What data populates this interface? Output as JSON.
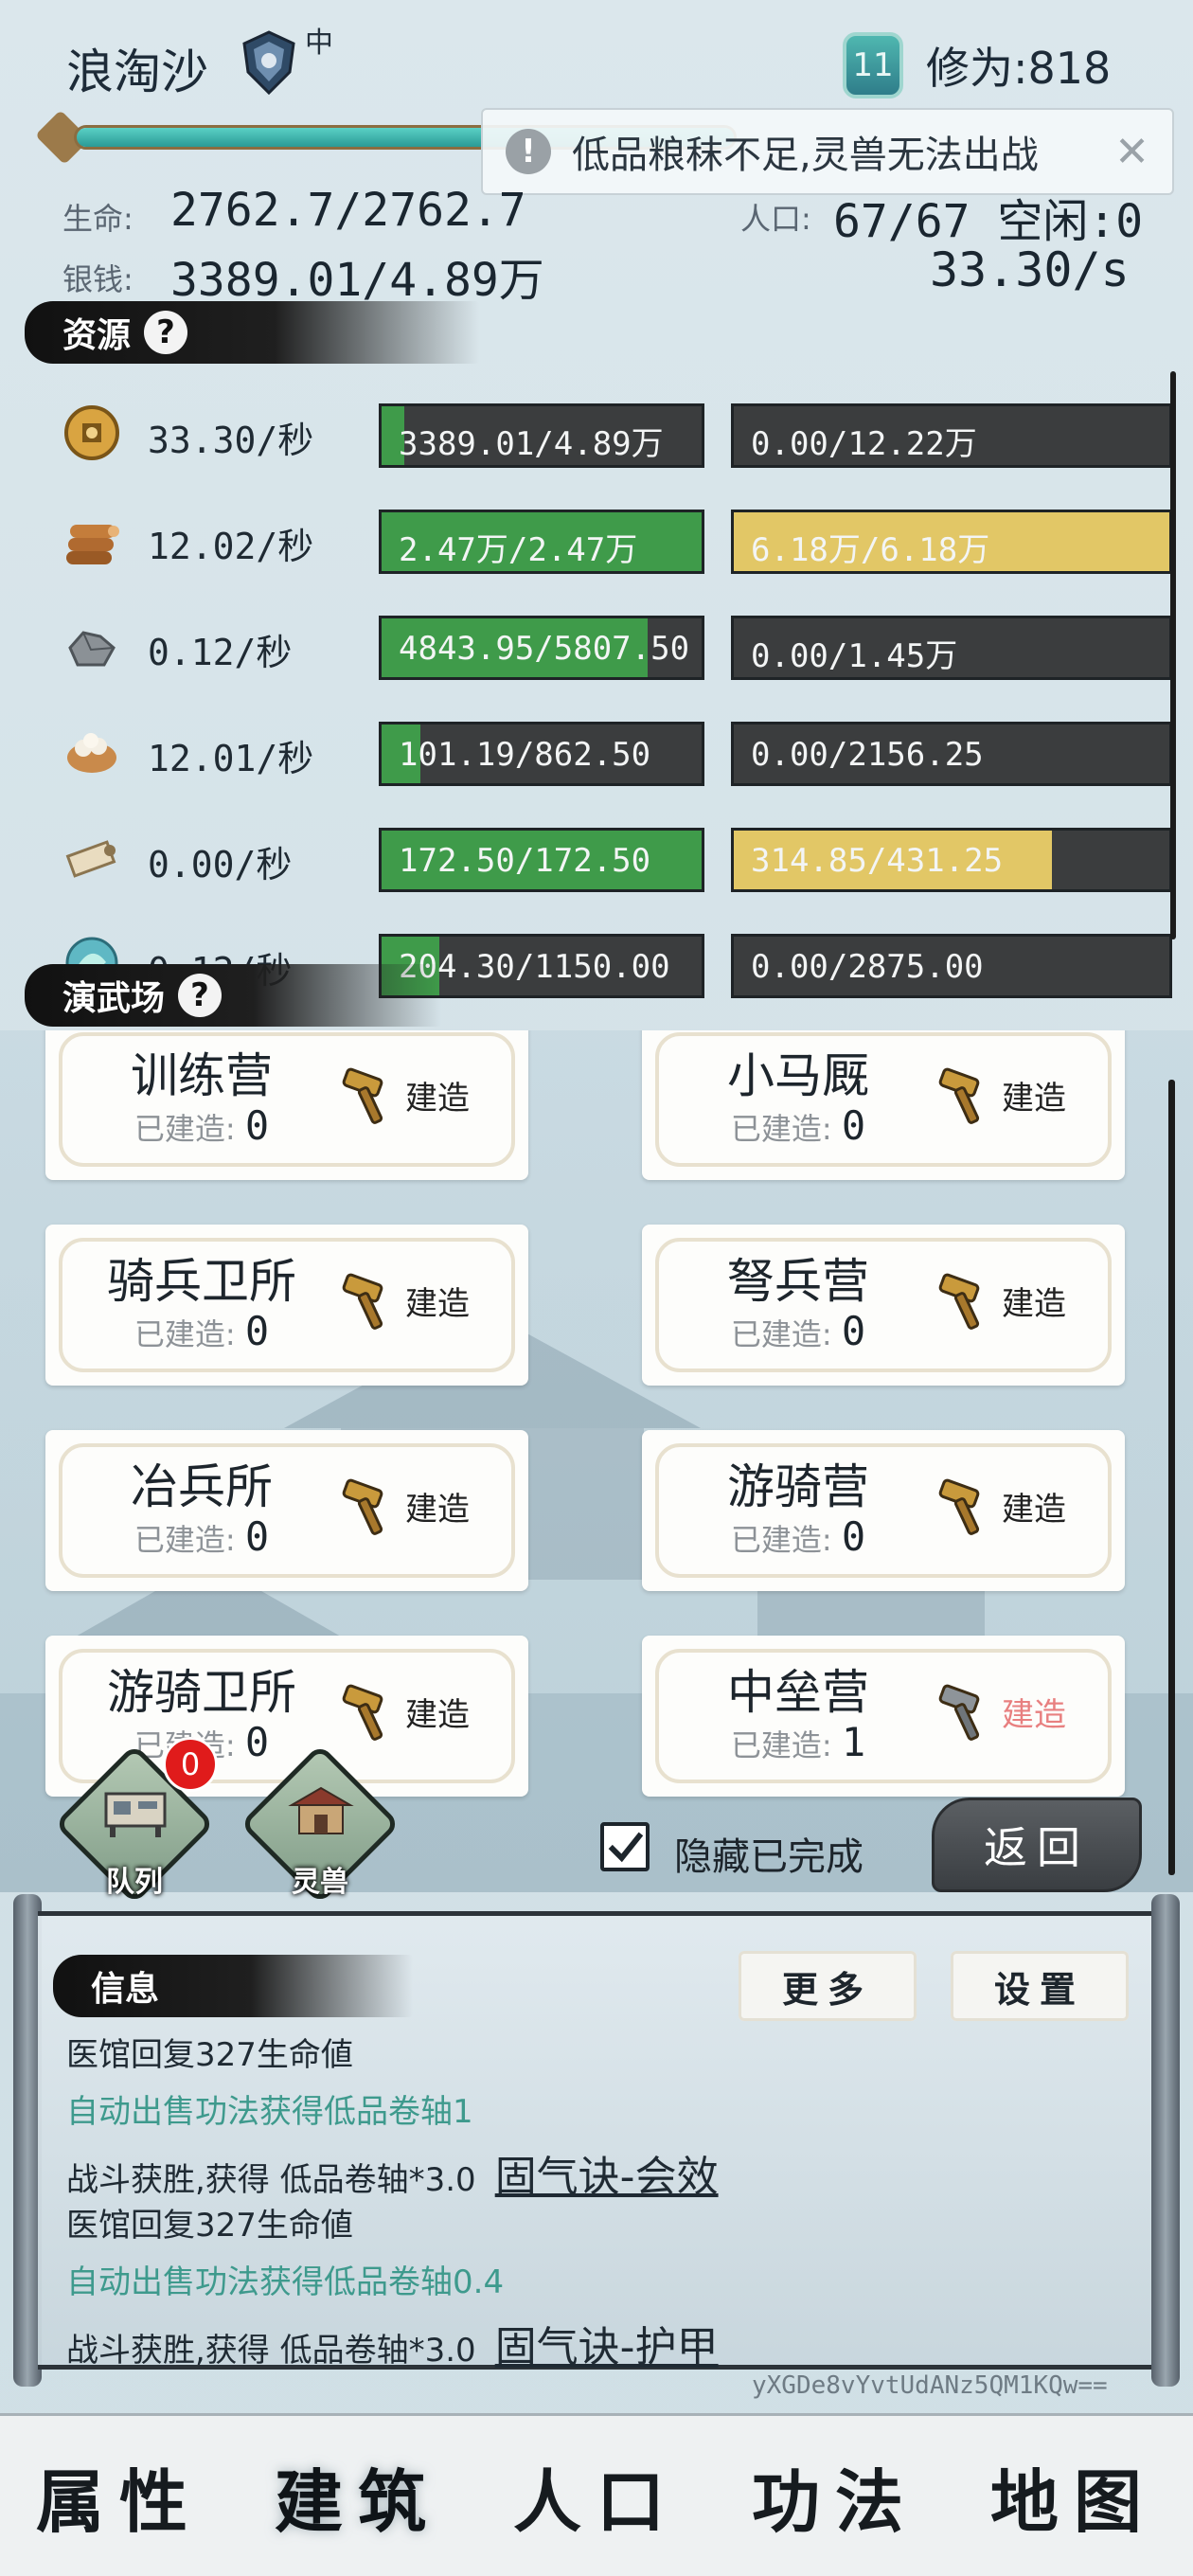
{
  "header": {
    "player_name": "浪淘沙",
    "rank_label": "中",
    "level": "11",
    "cultivation": "修为:818"
  },
  "toast": {
    "text": "低品粮秣不足,灵兽无法出战"
  },
  "stats": {
    "life_label": "生命:",
    "life_value": "2762.7/2762.7",
    "population_label": "人口:",
    "population_value": "67/67 空闲:0",
    "silver_label": "银钱:",
    "silver_value": "3389.01/4.89万",
    "silver_rate": "33.30/s",
    "hp_fraction": 1.0
  },
  "resources": {
    "header": "资源",
    "rows": [
      {
        "icon": "coin-icon",
        "rate": "33.30/秒",
        "a": "3389.01/4.89万",
        "a_fill": 0.07,
        "a_color": "g",
        "b": "0.00/12.22万",
        "b_fill": 0,
        "b_color": "y"
      },
      {
        "icon": "wood-logs-icon",
        "rate": "12.02/秒",
        "a": "2.47万/2.47万",
        "a_fill": 1.0,
        "a_color": "g",
        "b": "6.18万/6.18万",
        "b_fill": 1.0,
        "b_color": "y"
      },
      {
        "icon": "stone-ore-icon",
        "rate": "0.12/秒",
        "a": "4843.95/5807.50",
        "a_fill": 0.83,
        "a_color": "g",
        "b": "0.00/1.45万",
        "b_fill": 0,
        "b_color": "y"
      },
      {
        "icon": "grain-bowl-icon",
        "rate": "12.01/秒",
        "a": "101.19/862.50",
        "a_fill": 0.12,
        "a_color": "g",
        "b": "0.00/2156.25",
        "b_fill": 0,
        "b_color": "y"
      },
      {
        "icon": "scroll-icon",
        "rate": "0.00/秒",
        "a": "172.50/172.50",
        "a_fill": 1.0,
        "a_color": "g",
        "b": "314.85/431.25",
        "b_fill": 0.73,
        "b_color": "y"
      },
      {
        "icon": "spirit-orb-icon",
        "rate": "0.12/秒",
        "a": "204.30/1150.00",
        "a_fill": 0.18,
        "a_color": "g",
        "b": "0.00/2875.00",
        "b_fill": 0,
        "b_color": "y"
      }
    ]
  },
  "arena": {
    "header": "演武场",
    "built_label": "已建造:",
    "buildings": [
      {
        "name": "训练营",
        "count": "0",
        "action": "建造",
        "enabled": true
      },
      {
        "name": "小马厩",
        "count": "0",
        "action": "建造",
        "enabled": true
      },
      {
        "name": "骑兵卫所",
        "count": "0",
        "action": "建造",
        "enabled": true
      },
      {
        "name": "弩兵营",
        "count": "0",
        "action": "建造",
        "enabled": true
      },
      {
        "name": "冶兵所",
        "count": "0",
        "action": "建造",
        "enabled": true
      },
      {
        "name": "游骑营",
        "count": "0",
        "action": "建造",
        "enabled": true
      },
      {
        "name": "游骑卫所",
        "count": "0",
        "action": "建造",
        "enabled": true
      },
      {
        "name": "中垒营",
        "count": "1",
        "action": "建造",
        "enabled": false
      }
    ],
    "queue_label": "队列",
    "queue_count": "0",
    "spirit_label": "灵兽",
    "hide_completed": "隐藏已完成",
    "back": "返回"
  },
  "info": {
    "header": "信息",
    "more": "更多",
    "settings": "设置",
    "logs": [
      {
        "text": "医馆回复327生命値",
        "style": "normal",
        "link": ""
      },
      {
        "text": "自动出售功法获得低品卷轴1",
        "style": "teal",
        "link": ""
      },
      {
        "text": "战斗获胜,获得 低品卷轴*3.0",
        "style": "normal",
        "link": "固气诀-会效"
      },
      {
        "text": "医馆回复327生命値",
        "style": "normal",
        "link": ""
      },
      {
        "text": "自动出售功法获得低品卷轴0.4",
        "style": "teal",
        "link": ""
      },
      {
        "text": "战斗获胜,获得 低品卷轴*3.0",
        "style": "normal",
        "link": "固气诀-护甲"
      }
    ],
    "hash": "yXGDe8vYvtUdANz5QM1KQw=="
  },
  "nav": {
    "items": [
      "属性",
      "建筑",
      "人口",
      "功法",
      "地图"
    ],
    "active": 1
  }
}
